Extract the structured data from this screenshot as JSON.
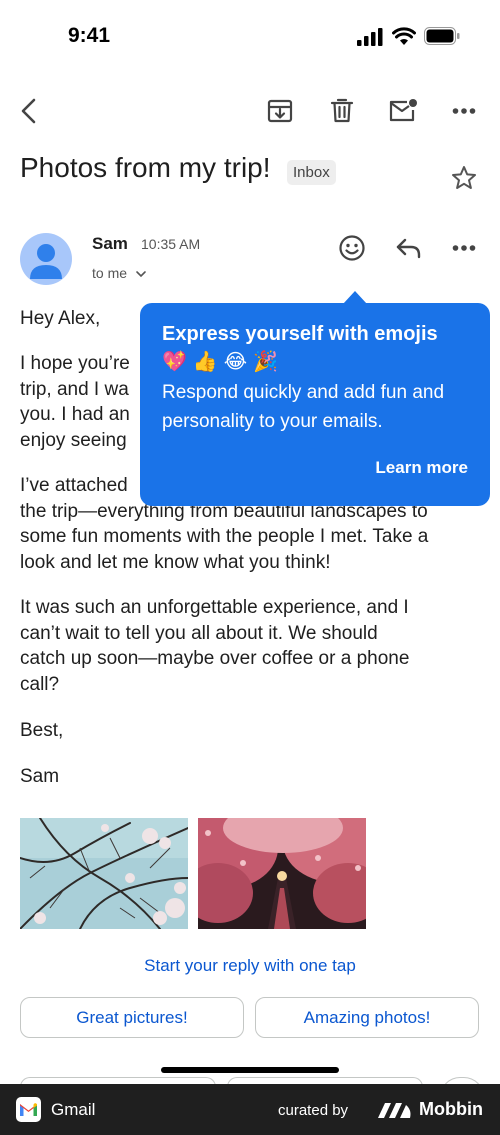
{
  "status_bar": {
    "time": "9:41"
  },
  "email": {
    "subject": "Photos from my trip!",
    "label": "Inbox",
    "sender": "Sam",
    "time": "10:35 AM",
    "recipient": "to me",
    "body": {
      "greeting": "Hey Alex,",
      "p1_visible_lines": [
        "I hope you’re",
        "trip, and I wa",
        "you. I had an",
        "enjoy seeing"
      ],
      "p2_visible_lines": [
        "I’ve attached",
        "the trip—everything from beautiful landscapes to",
        "some fun moments with the people I met. Take a",
        "look and let me know what you think!"
      ],
      "p3_lines": [
        "It was such an unforgettable experience, and I",
        "can’t wait to tell you all about it. We should",
        "catch up soon—maybe over coffee or a phone",
        "call?"
      ],
      "signoff": "Best,",
      "signature": "Sam"
    }
  },
  "tooltip": {
    "title": "Express yourself with emojis",
    "emojis": "💖👍😂🎉",
    "description": "Respond quickly and add fun and personality to your emails.",
    "link": "Learn more"
  },
  "smart_reply": {
    "hint": "Start your reply with one tap",
    "chips": [
      "Great pictures!",
      "Amazing photos!"
    ]
  },
  "footer": {
    "app": "Gmail",
    "curated": "curated by",
    "brand": "Mobbin"
  },
  "colors": {
    "accent": "#1a73e8",
    "link": "#0b57d0",
    "avatar": "#a8c7fa"
  }
}
